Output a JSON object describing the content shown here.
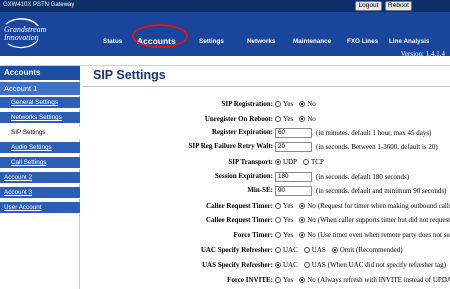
{
  "topbar": {
    "gateway_name": "GXW410X PSTN Gateway",
    "logout_label": "Logout",
    "reboot_label": "Reboot"
  },
  "header": {
    "logo_text_line1": "Grandstream",
    "logo_text_line2": "Innovation",
    "nav": [
      "Status",
      "Accounts",
      "Settings",
      "Networks",
      "Maintenance",
      "FXO Lines",
      "Line Analysis"
    ],
    "version": "Version: 1.4.1.4"
  },
  "sidebar": {
    "heading": "Accounts",
    "items": [
      {
        "label": "Account 1"
      },
      {
        "label": "General Settings"
      },
      {
        "label": "Networks Settings"
      },
      {
        "label": "SIP Settings"
      },
      {
        "label": "Audio Settings"
      },
      {
        "label": "Call Settings"
      },
      {
        "label": "Account 2"
      },
      {
        "label": "Account 3"
      },
      {
        "label": "User Account"
      }
    ]
  },
  "main": {
    "title": "SIP Settings",
    "rows": [
      {
        "label": "SIP Registration:",
        "options": [
          "Yes",
          "No"
        ],
        "selected": "No"
      },
      {
        "label": "Unregister On Reboot:",
        "options": [
          "Yes",
          "No"
        ],
        "selected": "No"
      },
      {
        "label": "Register Expiration:",
        "value": "60",
        "note": "(in minutes. default 1 hour, max 45 days)"
      },
      {
        "label": "SIP Reg Failure Retry Wait:",
        "value": "20",
        "note": "(in seconds. Between 1-3600, default is 20)"
      },
      {
        "label": "SIP Transport:",
        "options": [
          "UDP",
          "TCP"
        ],
        "selected": "UDP"
      },
      {
        "label": "Session Expiration:",
        "value": "180",
        "note": "(in seconds. default 180 seconds)"
      },
      {
        "label": "Min-SE:",
        "value": "90",
        "note": "(in seconds. default and minimum 90 seconds)"
      },
      {
        "label": "Caller Request Timer:",
        "options": [
          "Yes",
          "No"
        ],
        "selected": "No",
        "note": "(Request for timer when making outbound calls)"
      },
      {
        "label": "Callee Request Timer:",
        "options": [
          "Yes",
          "No"
        ],
        "selected": "No",
        "note": "(When caller supports timer but did not request one)"
      },
      {
        "label": "Force Timer:",
        "options": [
          "Yes",
          "No"
        ],
        "selected": "No",
        "note": "(Use timer even when remote party does not support)"
      },
      {
        "label": "UAC Specify Refresher:",
        "options": [
          "UAC",
          "UAS",
          "Omit (Recommended)"
        ],
        "selected": "Omit (Recommended)"
      },
      {
        "label": "UAS Specify Refresher:",
        "options": [
          "UAC",
          "UAS"
        ],
        "selected": "UAC",
        "note": "(When UAC did not specify refresher tag)"
      },
      {
        "label": "Force INVITE:",
        "options": [
          "Yes",
          "No"
        ],
        "selected": "No",
        "note": "(Always refresh with INVITE instead of UPDATE)"
      }
    ]
  },
  "colors": {
    "header_bg": "#19459c",
    "topbar_bg": "#0b2f66",
    "sidebar_item_bg": "#2a5fb5",
    "highlight_ring": "#e3141c",
    "title_color": "#15357a"
  }
}
